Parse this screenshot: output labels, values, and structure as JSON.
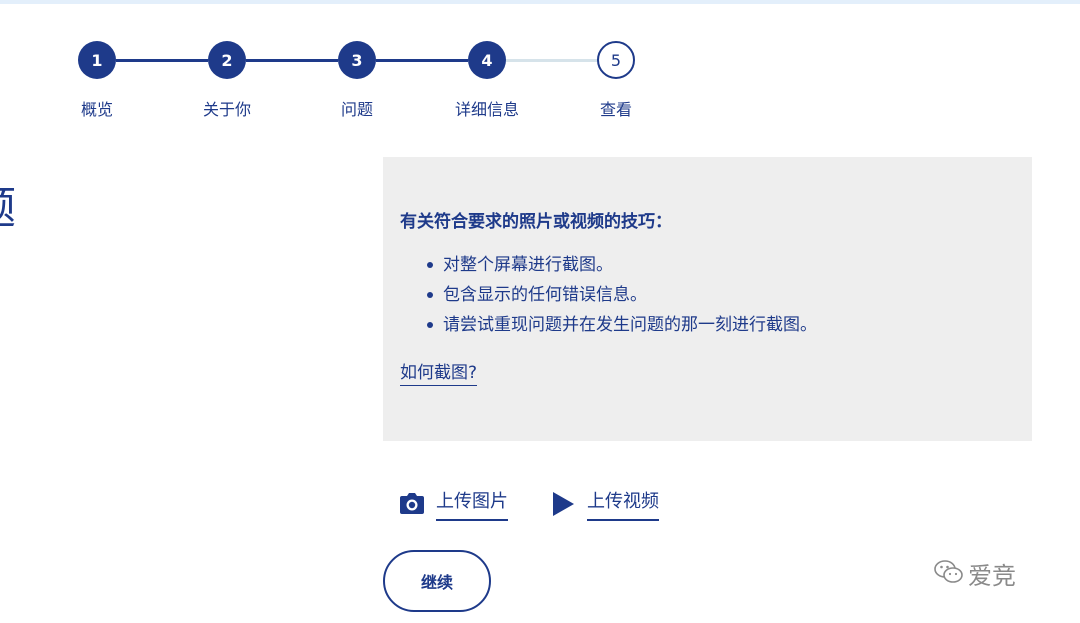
{
  "stepper": {
    "steps": [
      {
        "number": "1",
        "label": "概览",
        "state": "done"
      },
      {
        "number": "2",
        "label": "关于你",
        "state": "done"
      },
      {
        "number": "3",
        "label": "问题",
        "state": "done"
      },
      {
        "number": "4",
        "label": "详细信息",
        "state": "done"
      },
      {
        "number": "5",
        "label": "查看",
        "state": "todo"
      }
    ]
  },
  "left_heading": "题",
  "tips": {
    "title": "有关符合要求的照片或视频的技巧：",
    "items": [
      "对整个屏幕进行截图。",
      "包含显示的任何错误信息。",
      "请尝试重现问题并在发生问题的那一刻进行截图。"
    ],
    "link": "如何截图?"
  },
  "uploads": {
    "image_label": "上传图片",
    "image_icon": "camera-icon",
    "video_label": "上传视频",
    "video_icon": "play-icon"
  },
  "continue_label": "继续",
  "watermark": {
    "icon": "wechat-icon",
    "text": "爱竞"
  },
  "colors": {
    "primary": "#1e3a8a",
    "tips_background": "#eeeeee",
    "todo_line": "#d6e3ea",
    "top_band": "#e3effb",
    "watermark": "#8a8a8a"
  }
}
